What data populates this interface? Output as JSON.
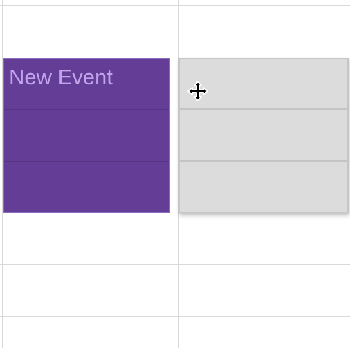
{
  "calendar": {
    "event": {
      "title": "New Event",
      "background_color": "#633d96",
      "title_color": "#c3a2ec"
    },
    "drag_preview": {
      "background_color": "#dcdcdc"
    },
    "cursor": {
      "icon": "move-cursor-icon"
    }
  }
}
